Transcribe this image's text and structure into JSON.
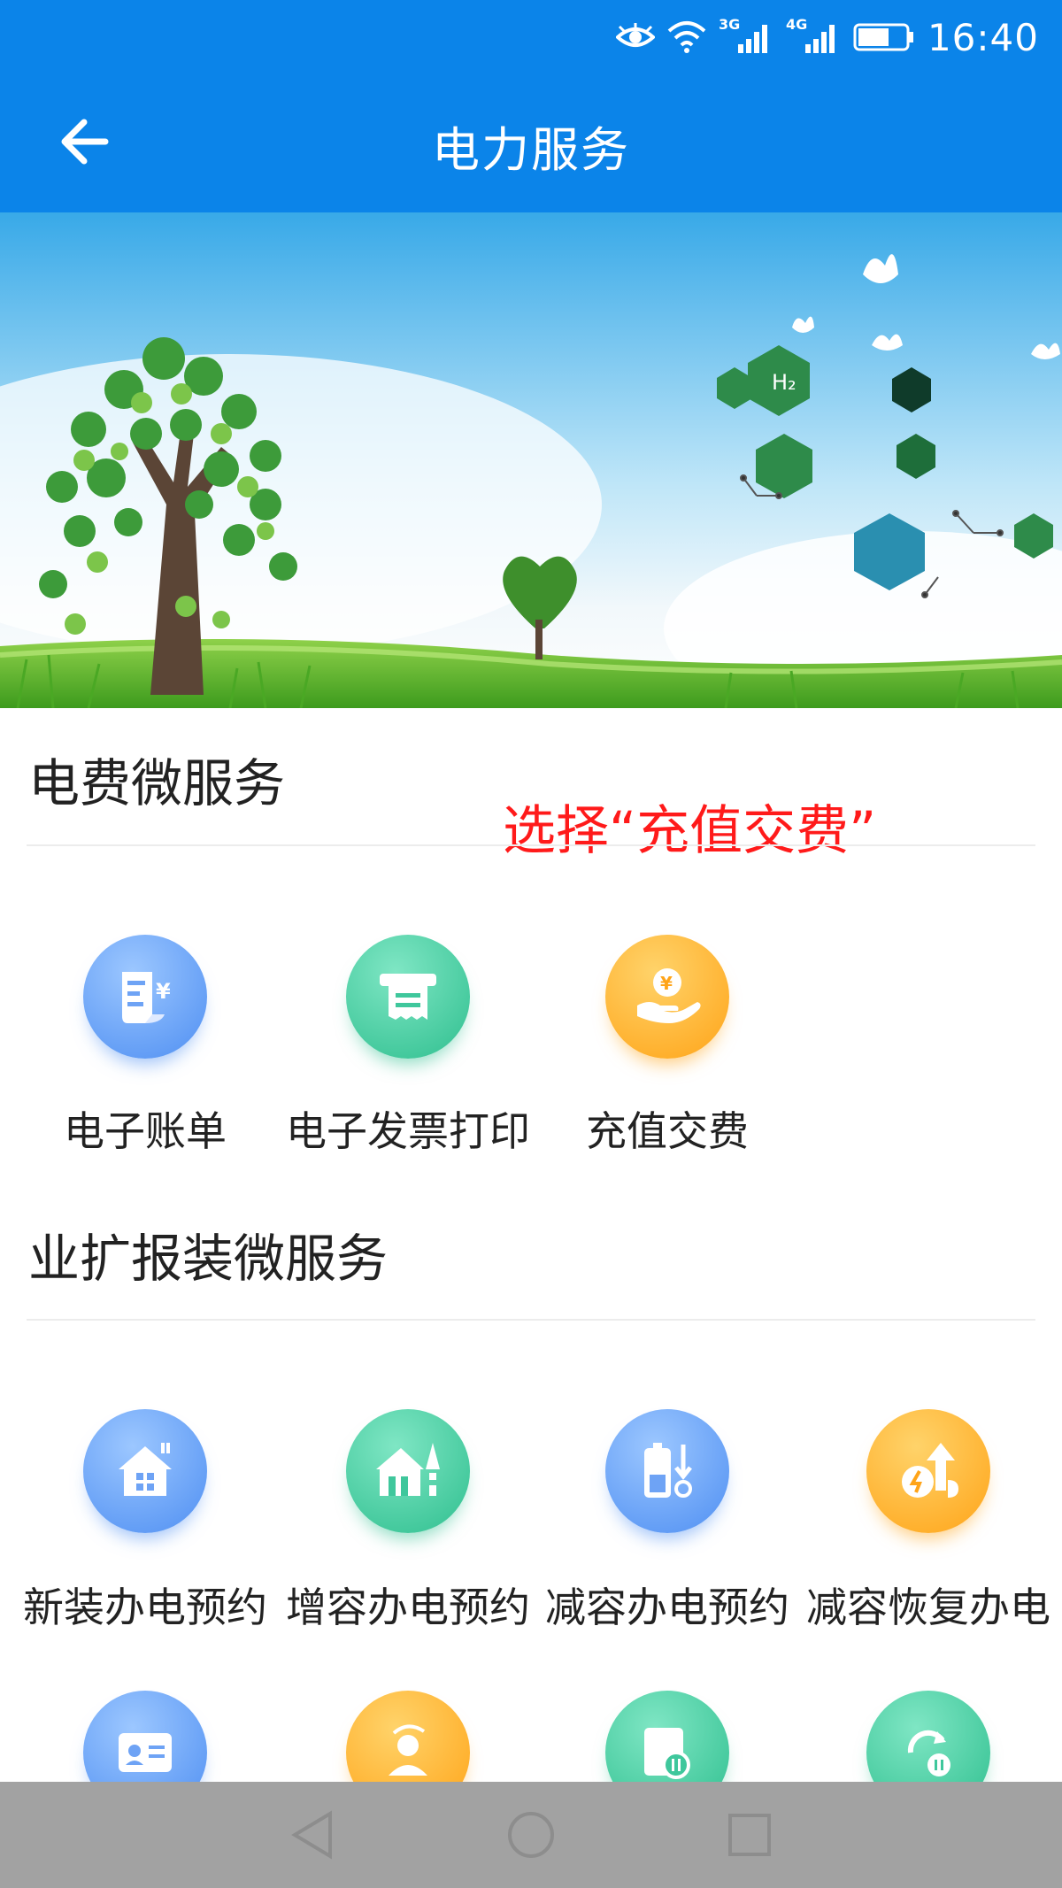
{
  "status_bar": {
    "time": "16:40",
    "network_3g": "3G",
    "network_4g": "4G"
  },
  "header": {
    "title": "电力服务",
    "back_icon": "arrow-left-icon"
  },
  "banner": {
    "hex_label": "H₂"
  },
  "annotation": {
    "text": "选择“充值交费”",
    "color": "#ff1a1a"
  },
  "sections": [
    {
      "title": "电费微服务",
      "items": [
        {
          "label": "电子账单",
          "icon": "bill-icon"
        },
        {
          "label": "电子发票打印",
          "icon": "invoice-print-icon"
        },
        {
          "label": "充值交费",
          "icon": "recharge-payment-icon"
        }
      ]
    },
    {
      "title": "业扩报装微服务",
      "items": [
        {
          "label": "新装办电预约",
          "icon": "new-install-house-icon"
        },
        {
          "label": "增容办电预约",
          "icon": "capacity-increase-icon"
        },
        {
          "label": "减容办电预约",
          "icon": "capacity-decrease-battery-icon"
        },
        {
          "label": "减容恢复办电",
          "icon": "capacity-restore-icon"
        }
      ]
    }
  ],
  "partial_row_icons": [
    "id-card-icon",
    "user-transfer-icon",
    "document-pause-icon",
    "refresh-pause-icon"
  ],
  "colors": {
    "header_blue": "#0b84e9",
    "icon_blue": "#4f8ff2",
    "icon_green": "#2fbf8f",
    "icon_orange": "#ffa418",
    "nav_gray": "#a2a2a2"
  }
}
